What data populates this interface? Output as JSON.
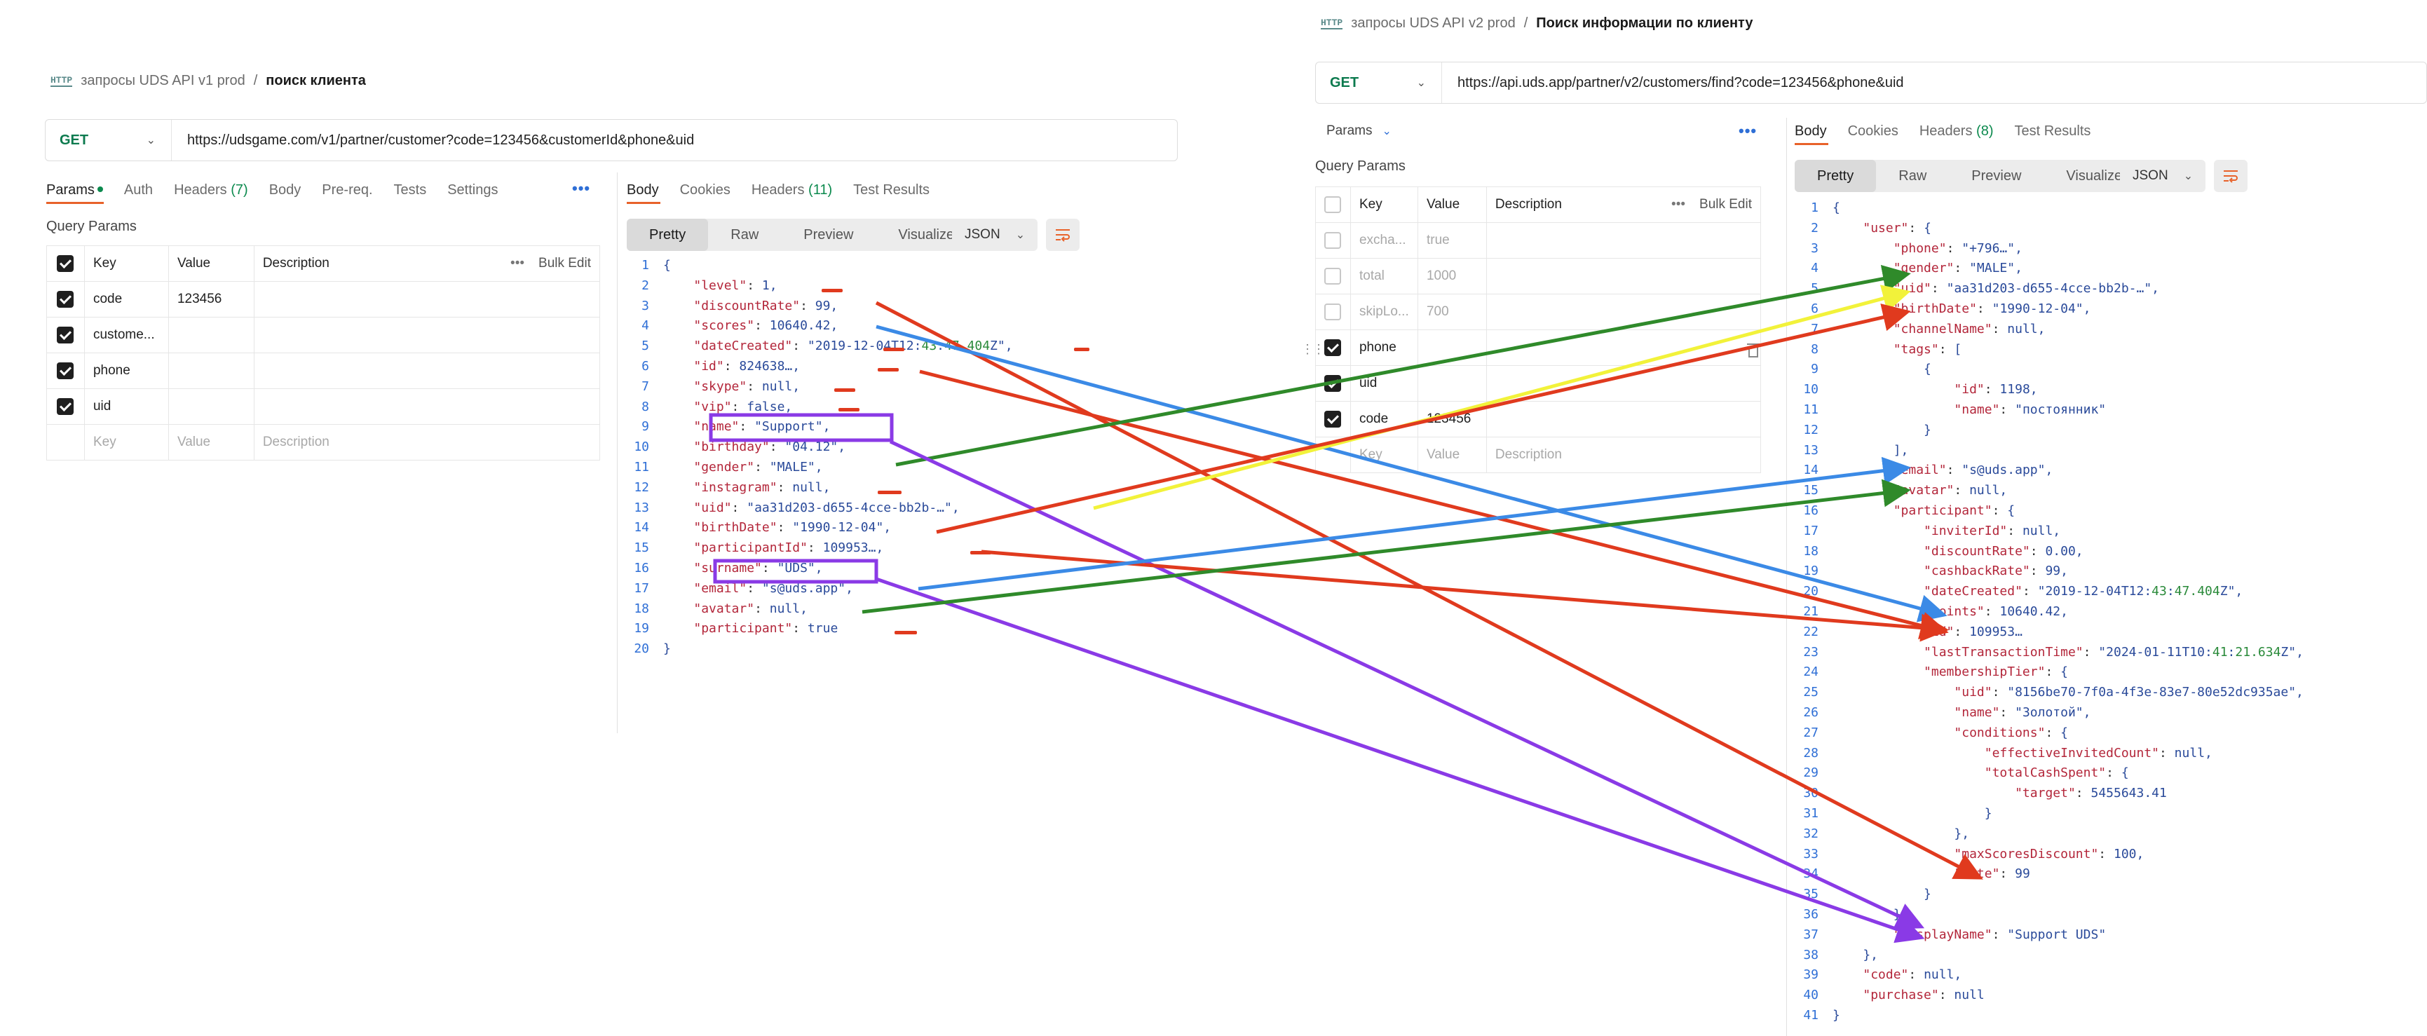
{
  "left": {
    "breadcrumb": {
      "icon": "HTTP",
      "collection": "запросы UDS API v1 prod",
      "separator": "/",
      "current": "поиск клиента"
    },
    "request": {
      "method": "GET",
      "url": "https://udsgame.com/v1/partner/customer?code=123456&customerId&phone&uid"
    },
    "tabs": [
      {
        "label": "Params",
        "dot": true
      },
      {
        "label": "Auth"
      },
      {
        "label": "Headers",
        "count": "(7)"
      },
      {
        "label": "Body"
      },
      {
        "label": "Pre-req."
      },
      {
        "label": "Tests"
      },
      {
        "label": "Settings"
      }
    ],
    "query_params_title": "Query Params",
    "params_header": {
      "key": "Key",
      "value": "Value",
      "description": "Description",
      "bulk_edit": "Bulk Edit"
    },
    "params": [
      {
        "key": "code",
        "value": "123456",
        "checked": true
      },
      {
        "key": "custome...",
        "value": "",
        "checked": true
      },
      {
        "key": "phone",
        "value": "",
        "checked": true
      },
      {
        "key": "uid",
        "value": "",
        "checked": true
      }
    ],
    "params_placeholder": {
      "key": "Key",
      "value": "Value",
      "description": "Description"
    },
    "response_tabs": [
      {
        "label": "Body",
        "active": true
      },
      {
        "label": "Cookies"
      },
      {
        "label": "Headers",
        "count": "(11)"
      },
      {
        "label": "Test Results"
      }
    ],
    "view_modes": [
      "Pretty",
      "Raw",
      "Preview",
      "Visualize"
    ],
    "format": "JSON",
    "code_lines": [
      "{",
      "    \"level\": 1,",
      "    \"discountRate\": 99,",
      "    \"scores\": 10640.42,",
      "    \"dateCreated\": \"2019-12-04T12:43:47.404Z\",",
      "    \"id\": 824638…,",
      "    \"skype\": null,",
      "    \"vip\": false,",
      "    \"name\": \"Support\",",
      "    \"birthday\": \"04.12\",",
      "    \"gender\": \"MALE\",",
      "    \"instagram\": null,",
      "    \"uid\": \"aa31d203-d655-4cce-bb2b-…\",",
      "    \"birthDate\": \"1990-12-04\",",
      "    \"participantId\": 109953…,",
      "    \"surname\": \"UDS\",",
      "    \"email\": \"s@uds.app\",",
      "    \"avatar\": null,",
      "    \"participant\": true",
      "}"
    ]
  },
  "right": {
    "breadcrumb": {
      "icon": "HTTP",
      "collection": "запросы UDS API v2 prod",
      "separator": "/",
      "current": "Поиск информации по клиенту"
    },
    "request": {
      "method": "GET",
      "url": "https://api.uds.app/partner/v2/customers/find?code=123456&phone&uid"
    },
    "params_tab": "Params",
    "query_params_title": "Query Params",
    "params_header": {
      "key": "Key",
      "value": "Value",
      "description": "Description",
      "bulk_edit": "Bulk Edit"
    },
    "params": [
      {
        "key": "excha...",
        "value": "true",
        "checked": false
      },
      {
        "key": "total",
        "value": "1000",
        "checked": false
      },
      {
        "key": "skipLo...",
        "value": "700",
        "checked": false
      },
      {
        "key": "phone",
        "value": "",
        "checked": true
      },
      {
        "key": "uid",
        "value": "",
        "checked": true
      },
      {
        "key": "code",
        "value": "123456",
        "checked": true
      }
    ],
    "params_placeholder": {
      "key": "Key",
      "value": "Value",
      "description": "Description"
    },
    "response_tabs": [
      {
        "label": "Body",
        "active": true
      },
      {
        "label": "Cookies"
      },
      {
        "label": "Headers",
        "count": "(8)"
      },
      {
        "label": "Test Results"
      }
    ],
    "view_modes": [
      "Pretty",
      "Raw",
      "Preview",
      "Visualize"
    ],
    "format": "JSON",
    "code_lines": [
      "{",
      "    \"user\": {",
      "        \"phone\": \"+796…\",",
      "        \"gender\": \"MALE\",",
      "        \"uid\": \"aa31d203-d655-4cce-bb2b-…\",",
      "        \"birthDate\": \"1990-12-04\",",
      "        \"channelName\": null,",
      "        \"tags\": [",
      "            {",
      "                \"id\": 1198,",
      "                \"name\": \"постоянник\"",
      "            }",
      "        ],",
      "        \"email\": \"s@uds.app\",",
      "        \"avatar\": null,",
      "        \"participant\": {",
      "            \"inviterId\": null,",
      "            \"discountRate\": 0.00,",
      "            \"cashbackRate\": 99,",
      "            \"dateCreated\": \"2019-12-04T12:43:47.404Z\",",
      "            \"points\": 10640.42,",
      "            \"id\": 109953…",
      "            \"lastTransactionTime\": \"2024-01-11T10:41:21.634Z\",",
      "            \"membershipTier\": {",
      "                \"uid\": \"8156be70-7f0a-4f3e-83e7-80e52dc935ae\",",
      "                \"name\": \"Золотой\",",
      "                \"conditions\": {",
      "                    \"effectiveInvitedCount\": null,",
      "                    \"totalCashSpent\": {",
      "                        \"target\": 5455643.41",
      "                    }",
      "                },",
      "                \"maxScoresDiscount\": 100,",
      "                \"rate\": 99",
      "            }",
      "        },",
      "        \"displayName\": \"Support UDS\"",
      "    },",
      "    \"code\": null,",
      "    \"purchase\": null",
      "}"
    ]
  },
  "annotation_colors": {
    "red": "#e03a1e",
    "green": "#2f8a2a",
    "blue": "#3b8ae6",
    "yellow": "#f2f23a",
    "purple": "#8a3ae6"
  }
}
